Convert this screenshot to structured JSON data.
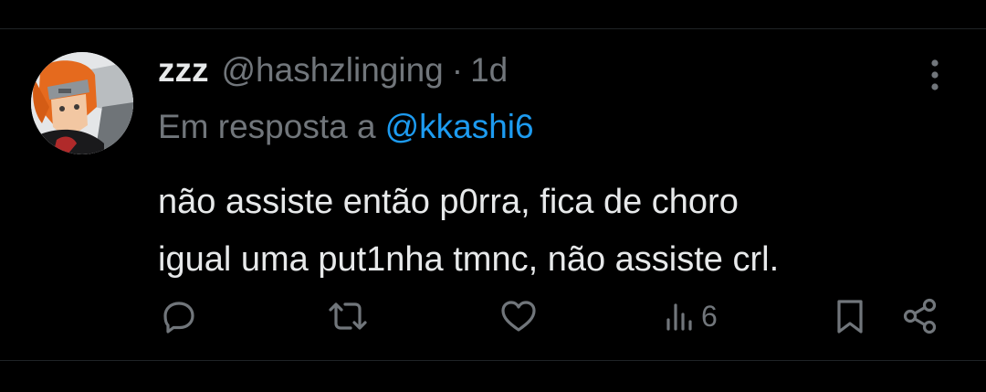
{
  "tweet": {
    "display_name": "zzz",
    "handle": "@hashzlinging",
    "separator": "·",
    "time": "1d",
    "reply_prefix": "Em resposta a",
    "reply_to": "@kkashi6",
    "text_lines": [
      "não assiste então p0rra, fica de choro",
      "igual uma put1nha tmnc, não assiste crl."
    ]
  },
  "actions": {
    "views_count": "6"
  },
  "icons": {
    "more": "more-vertical-icon",
    "reply": "reply-icon",
    "repost": "repost-icon",
    "like": "heart-icon",
    "views": "views-chart-icon",
    "bookmark": "bookmark-icon",
    "share": "share-icon"
  },
  "colors": {
    "background": "#000000",
    "primary_text": "#e7e9ea",
    "secondary_text": "#71767b",
    "link": "#1d9bf0",
    "divider": "#1f2326"
  }
}
